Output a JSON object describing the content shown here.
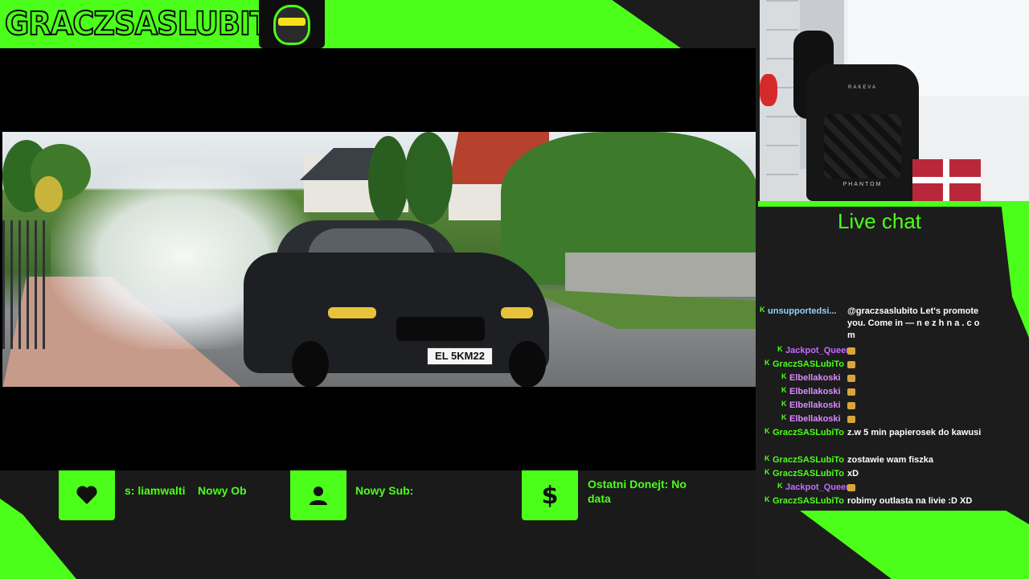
{
  "header": {
    "channel_name": "GRACZSASLUBITO"
  },
  "video": {
    "license_plate": "EL 5KM22"
  },
  "camera": {
    "chair_brand_top": "RAKEVA",
    "chair_brand_bottom": "PHANTOM"
  },
  "stats": [
    {
      "icon": "heart-icon",
      "text": "s: liamwalti    Nowy Ob"
    },
    {
      "icon": "user-icon",
      "text": "Nowy Sub:"
    },
    {
      "icon": "dollar-icon",
      "text": "Ostatni Donejt: No data"
    }
  ],
  "chat": {
    "title": "Live chat",
    "messages": [
      {
        "user": "unsupportedsi...",
        "color": "#8fd3ff",
        "text": "@graczsaslubito Let's promote you. Come in — n e z h n a . c o m",
        "badge": true
      },
      {
        "user": "Jackpot_Queen",
        "color": "#c46bff",
        "text": "",
        "emote": true,
        "badge": true
      },
      {
        "user": "GraczSASLubiTo",
        "color": "#4cff1a",
        "text": "",
        "emote": true,
        "badge": true
      },
      {
        "user": "Elbellakoski",
        "color": "#d98bff",
        "text": "",
        "emote": true,
        "badge": true
      },
      {
        "user": "Elbellakoski",
        "color": "#d98bff",
        "text": "",
        "emote": true,
        "badge": true
      },
      {
        "user": "Elbellakoski",
        "color": "#d98bff",
        "text": "",
        "emote": true,
        "badge": true
      },
      {
        "user": "Elbellakoski",
        "color": "#d98bff",
        "text": "",
        "emote": true,
        "badge": true
      },
      {
        "user": "GraczSASLubiTo",
        "color": "#4cff1a",
        "text": "z.w 5 min papierosek do kawusi",
        "badge": true
      },
      {
        "user": "GraczSASLubiTo",
        "color": "#4cff1a",
        "text": "zostawie wam fiszka",
        "badge": true
      },
      {
        "user": "GraczSASLubiTo",
        "color": "#4cff1a",
        "text": "xD",
        "badge": true
      },
      {
        "user": "Jackpot_Queen",
        "color": "#c46bff",
        "text": "",
        "emote": true,
        "badge": true
      },
      {
        "user": "GraczSASLubiTo",
        "color": "#4cff1a",
        "text": "robimy outlasta na livie :D XD",
        "badge": true
      }
    ]
  },
  "colors": {
    "accent": "#4cff1a",
    "background": "#1c1c1c"
  }
}
